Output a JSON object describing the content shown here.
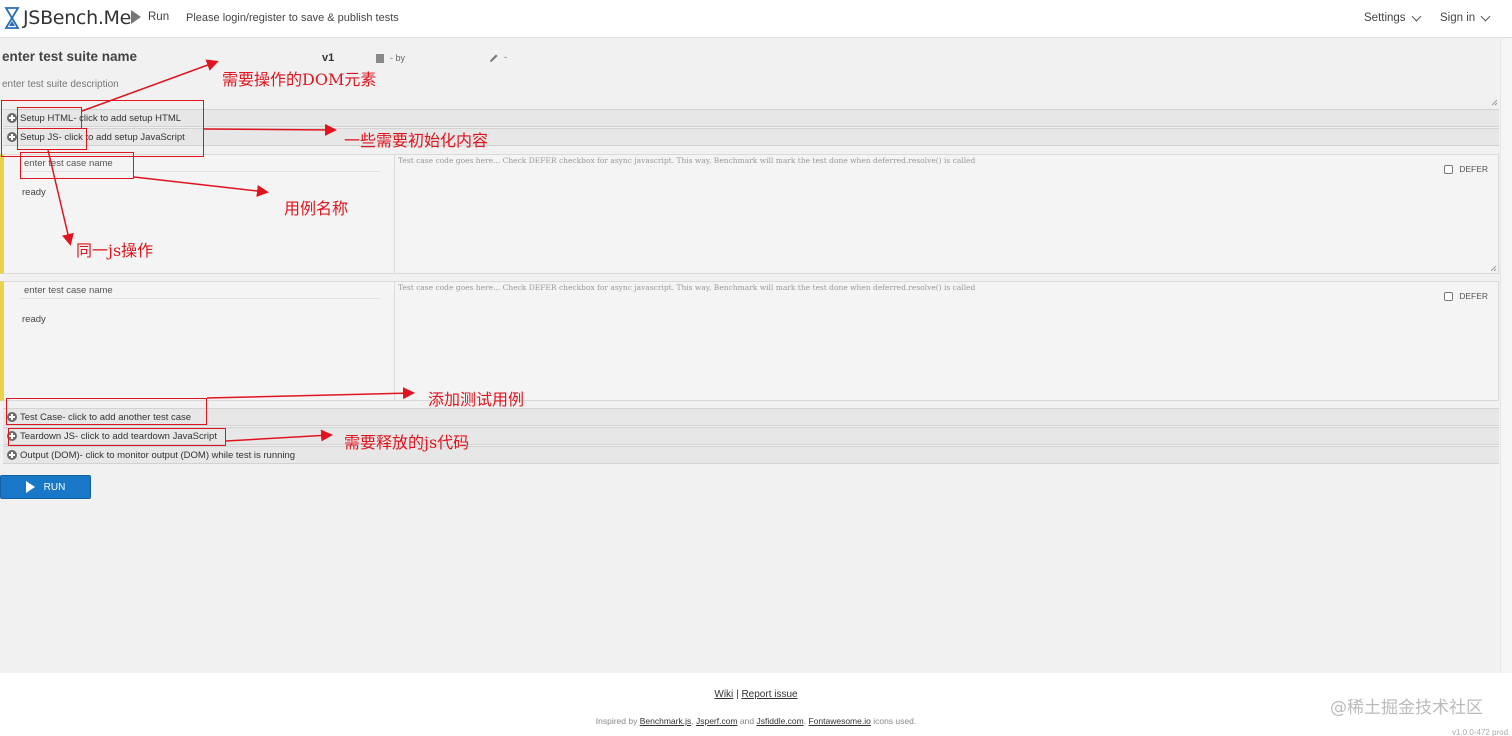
{
  "nav": {
    "brand": "JSBench.Me",
    "run_label": "Run",
    "login_text": "Please login/register to save & publish tests",
    "settings_label": "Settings",
    "signin_label": "Sign in"
  },
  "suite": {
    "name": "enter test suite name",
    "version": "v1",
    "by_label": "- by",
    "pencil_suffix": "-",
    "description": "enter test suite description"
  },
  "sections": {
    "setup_html": {
      "title": "Setup HTML",
      "hint": " - click to add setup HTML"
    },
    "setup_js": {
      "title": "Setup JS",
      "hint": " - click to add setup JavaScript"
    },
    "add_test_case": {
      "title": "Test Case",
      "hint": " - click to add another test case"
    },
    "teardown_js": {
      "title": "Teardown JS",
      "hint": " - click to add teardown JavaScript"
    },
    "output_dom": {
      "title": "Output (DOM)",
      "hint": " - click to monitor output (DOM) while test is running"
    }
  },
  "test_cases": [
    {
      "name_placeholder": "enter test case name",
      "status": "ready",
      "code_placeholder": "Test case code goes here... Check DEFER checkbox for async javascript. This way, Benchmark will mark the test done when deferred.resolve() is called",
      "defer_label": "DEFER"
    },
    {
      "name_placeholder": "enter test case name",
      "status": "ready",
      "code_placeholder": "Test case code goes here... Check DEFER checkbox for async javascript. This way, Benchmark will mark the test done when deferred.resolve() is called",
      "defer_label": "DEFER"
    }
  ],
  "run_button": "RUN",
  "footer": {
    "wiki": "Wiki",
    "separator": "|",
    "report": "Report issue",
    "inspired_prefix": "Inspired by",
    "benchmark": "Benchmark.js",
    "jsperf": "Jsperf.com",
    "and": "and",
    "jsfiddle": "Jsfiddle.com",
    "fontawesome": "Fontawesome.io",
    "icons_used": "icons used."
  },
  "watermark": "@稀土掘金技术社区",
  "version_text": "v1.0.0-472 prod",
  "annotations": {
    "dom_elements": "需要操作的DOM元素",
    "init_content": "一些需要初始化内容",
    "case_name": "用例名称",
    "same_js": "同一js操作",
    "add_case": "添加测试用例",
    "release_js": "需要释放的js代码"
  },
  "colors": {
    "accent_blue": "#1977c8",
    "annotation_red": "#e0141e",
    "testcase_stripe": "#e8d24a"
  }
}
